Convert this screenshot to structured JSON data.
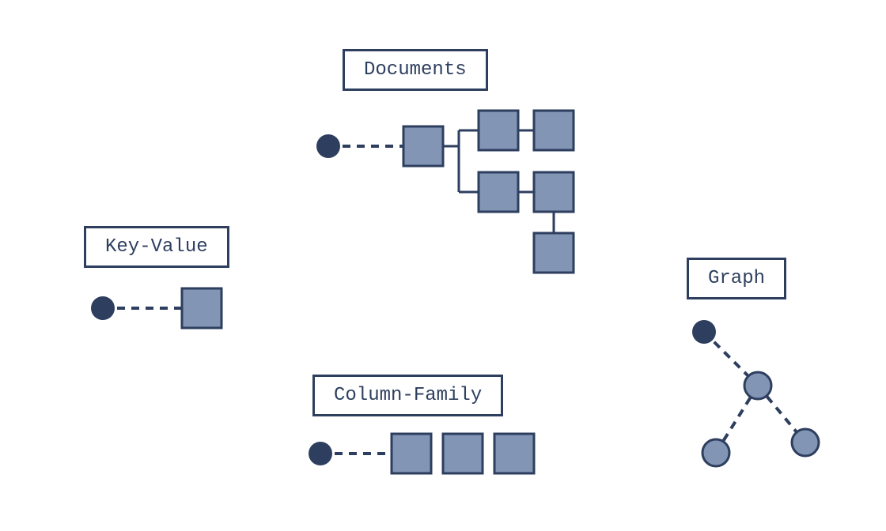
{
  "labels": {
    "keyvalue": "Key-Value",
    "documents": "Documents",
    "columnfamily": "Column-Family",
    "graph": "Graph"
  },
  "colors": {
    "dark": "#2d3e5e",
    "light": "#8295b5",
    "border": "#2d3e5e"
  }
}
